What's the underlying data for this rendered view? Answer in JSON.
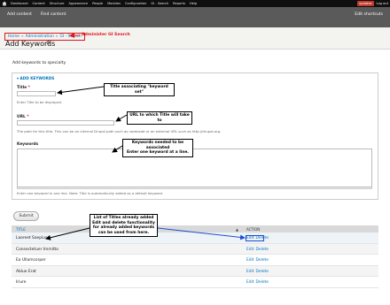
{
  "toolbar": {
    "items": [
      "Dashboard",
      "Content",
      "Structure",
      "Appearance",
      "People",
      "Modules",
      "Configuration",
      "GI - Search",
      "Reports",
      "Help"
    ],
    "updates": "updates",
    "logout": "Log out"
  },
  "shortcuts": {
    "add_content": "Add content",
    "find_content": "Find content",
    "edit_shortcuts": "Edit shortcuts"
  },
  "header": {
    "breadcrumb": [
      "Home",
      "Administration",
      "GI - Search"
    ],
    "breadcrumb_sep": "»",
    "breadcrumb_note": "Administer GI Search",
    "page_title": "Add Keywords",
    "gear": "⚙"
  },
  "form": {
    "intro": "Add keywords to specialty",
    "legend": "▾ ADD KEYWORDS",
    "title_label": "Title",
    "title_required": "*",
    "title_desc": "Enter Title to be displayed.",
    "url_label": "URL",
    "url_required": "*",
    "url_desc": "The path for this title. This can be an internal Drupal path such as node/add or an external URL such as http://drupal.org.",
    "keywords_label": "Keywords",
    "keywords_desc": "Enter one keyword in one line. Note: Title is automatically added as a default keyword.",
    "submit": "Submit"
  },
  "callouts": {
    "title": "Title associating \"keyword set\"",
    "url": "URL to which Title will take to",
    "keywords_line1": "Keywords needed to be associated",
    "keywords_line2": "Enter one keyword at a line.",
    "list_line1": "List of Titles already added",
    "list_line2": "Edit and delete functionality",
    "list_line3": "for already added keywords",
    "list_line4": "can be used from here."
  },
  "table": {
    "col_title": "TITLE",
    "col_action": "ACTION",
    "sort_icon": "▲",
    "rows": [
      {
        "title": "Laoreet Saepius",
        "edit": "Edit",
        "delete": "Delete"
      },
      {
        "title": "Consectetuer Immitto",
        "edit": "Edit",
        "delete": "Delete"
      },
      {
        "title": "Ea Ullamcorper",
        "edit": "Edit",
        "delete": "Delete"
      },
      {
        "title": "Abluo Erat",
        "edit": "Edit",
        "delete": "Delete"
      },
      {
        "title": "Iriure",
        "edit": "Edit",
        "delete": "Delete"
      }
    ]
  },
  "colors": {
    "toolbar": "#0f0f0f",
    "shortcuts": "#5a5a5a",
    "link": "#0074bd",
    "annotation_red": "#e0161c",
    "annotation_blue": "#1a4fd0"
  }
}
